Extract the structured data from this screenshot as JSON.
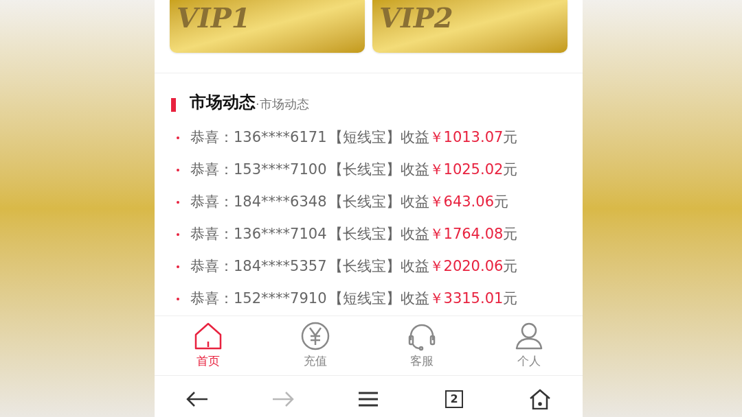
{
  "vip_cards": [
    {
      "label": "VIP1"
    },
    {
      "label": "VIP2"
    }
  ],
  "market": {
    "title": "市场动态",
    "subtitle": "·市场动态",
    "rows": [
      {
        "label": "恭喜：",
        "phone": "136****6171",
        "product": "【短线宝】",
        "income_label": "收益",
        "amount": "￥1013.07",
        "unit": "元"
      },
      {
        "label": "恭喜：",
        "phone": "153****7100",
        "product": "【长线宝】",
        "income_label": "收益",
        "amount": "￥1025.02",
        "unit": "元"
      },
      {
        "label": "恭喜：",
        "phone": "184****6348",
        "product": "【长线宝】",
        "income_label": "收益",
        "amount": "￥643.06",
        "unit": "元"
      },
      {
        "label": "恭喜：",
        "phone": "136****7104",
        "product": "【长线宝】",
        "income_label": "收益",
        "amount": "￥1764.08",
        "unit": "元"
      },
      {
        "label": "恭喜：",
        "phone": "184****5357",
        "product": "【长线宝】",
        "income_label": "收益",
        "amount": "￥2020.06",
        "unit": "元"
      },
      {
        "label": "恭喜：",
        "phone": "152****7910",
        "product": "【短线宝】",
        "income_label": "收益",
        "amount": "￥3315.01",
        "unit": "元"
      }
    ]
  },
  "tab_bar": [
    {
      "kind": "home",
      "label": "首页",
      "selected": true
    },
    {
      "kind": "recharge",
      "label": "充值",
      "selected": false
    },
    {
      "kind": "service",
      "label": "客服",
      "selected": false
    },
    {
      "kind": "profile",
      "label": "个人",
      "selected": false
    }
  ],
  "browser_bar": [
    {
      "kind": "back",
      "disabled": false
    },
    {
      "kind": "forward",
      "disabled": true
    },
    {
      "kind": "menu",
      "disabled": false
    },
    {
      "kind": "tabs",
      "count": "2",
      "disabled": false
    },
    {
      "kind": "home",
      "disabled": false
    }
  ]
}
